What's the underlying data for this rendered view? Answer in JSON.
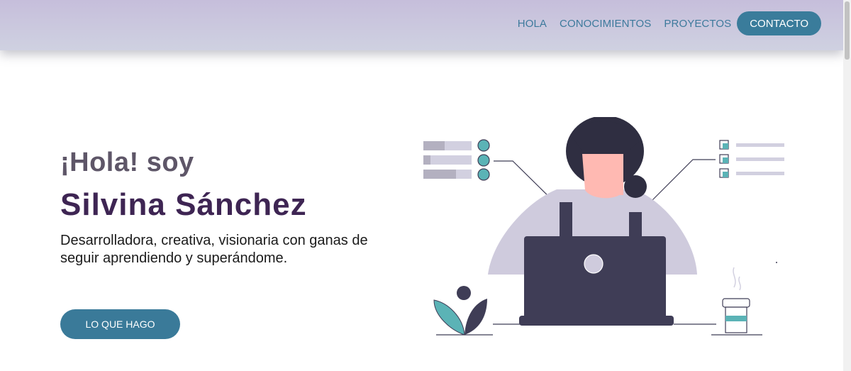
{
  "nav": {
    "links": [
      "HOLA",
      "CONOCIMIENTOS",
      "PROYECTOS"
    ],
    "cta": "CONTACTO"
  },
  "hero": {
    "greeting": "¡Hola! soy",
    "name": "Silvina Sánchez",
    "description": "Desarrolladora, creativa, visionaria con ganas de seguir aprendiendo y superándome.",
    "cta": "LO QUE HAGO"
  },
  "colors": {
    "accent": "#3a7c9b",
    "name_text": "#3e2553",
    "greeting_text": "#5e5668",
    "teal_illustration": "#5bb3b6",
    "laptop": "#3f3d56"
  },
  "icons": [
    "person-at-laptop-illustration",
    "checklist-icon",
    "plant-icon",
    "coffee-cup-icon"
  ]
}
